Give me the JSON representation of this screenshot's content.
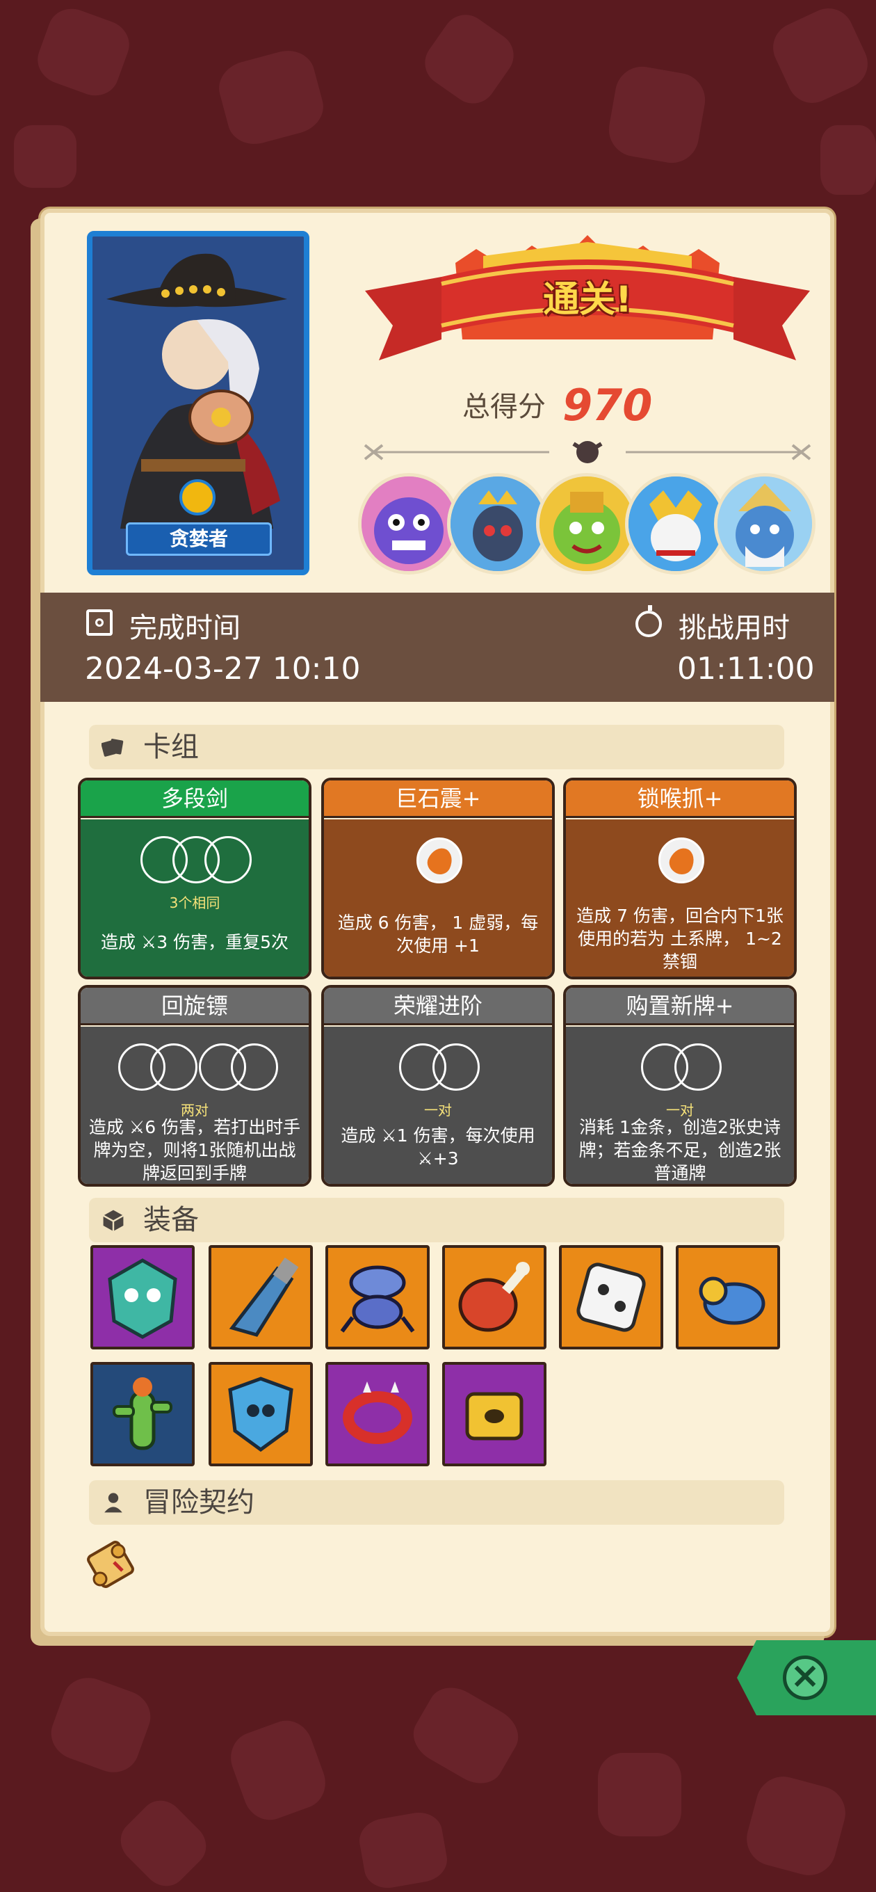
{
  "character": {
    "name": "贪婪者"
  },
  "result": {
    "banner": "通关!",
    "score_label": "总得分",
    "score": "970"
  },
  "bosses": [
    "boss-1",
    "boss-2",
    "boss-3",
    "boss-4",
    "boss-5"
  ],
  "time": {
    "finish_label": "完成时间",
    "finish_value": "2024-03-27 10:10",
    "challenge_label": "挑战用时",
    "challenge_value": "01:11:00"
  },
  "sections": {
    "deck": "卡组",
    "equipment": "装备",
    "contract": "冒险契约"
  },
  "cards": [
    {
      "title": "多段剑",
      "sub": "3个相同",
      "text": "造成 ⚔3 伤害，重复5次",
      "color": "green"
    },
    {
      "title": "巨石震+",
      "sub": "",
      "text": "造成 6 伤害， 1 虚弱，每次使用 +1",
      "color": "orange"
    },
    {
      "title": "锁喉抓+",
      "sub": "",
      "text": "造成 7 伤害，回合内下1张使用的若为 土系牌， 1~2 禁锢",
      "color": "orange"
    },
    {
      "title": "回旋镖",
      "sub": "两对",
      "text": "造成 ⚔6 伤害，若打出时手牌为空，则将1张随机出战牌返回到手牌",
      "color": "gray"
    },
    {
      "title": "荣耀进阶",
      "sub": "一对",
      "text": "造成 ⚔1 伤害，每次使用 ⚔+3",
      "color": "gray"
    },
    {
      "title": "购置新牌+",
      "sub": "一对",
      "text": "消耗 1金条，创造2张史诗牌；若金条不足，创造2张普通牌",
      "color": "gray"
    }
  ],
  "equipment": [
    {
      "name": "green-mask-icon",
      "bg": "purple"
    },
    {
      "name": "broken-sword-icon",
      "bg": "orange"
    },
    {
      "name": "crab-creature-icon",
      "bg": "orange"
    },
    {
      "name": "ham-icon",
      "bg": "orange"
    },
    {
      "name": "white-dice-icon",
      "bg": "orange"
    },
    {
      "name": "blue-blob-icon",
      "bg": "orange"
    },
    {
      "name": "cactus-doll-icon",
      "bg": "blue"
    },
    {
      "name": "skull-shield-icon",
      "bg": "orange"
    },
    {
      "name": "spiked-bracelet-icon",
      "bg": "purple"
    },
    {
      "name": "golden-chest-icon",
      "bg": "purple"
    }
  ],
  "colors": {
    "accent": "#e54a32",
    "panel": "#fbf1d8",
    "timebar": "#6b4f3f",
    "close": "#2aa35c"
  }
}
